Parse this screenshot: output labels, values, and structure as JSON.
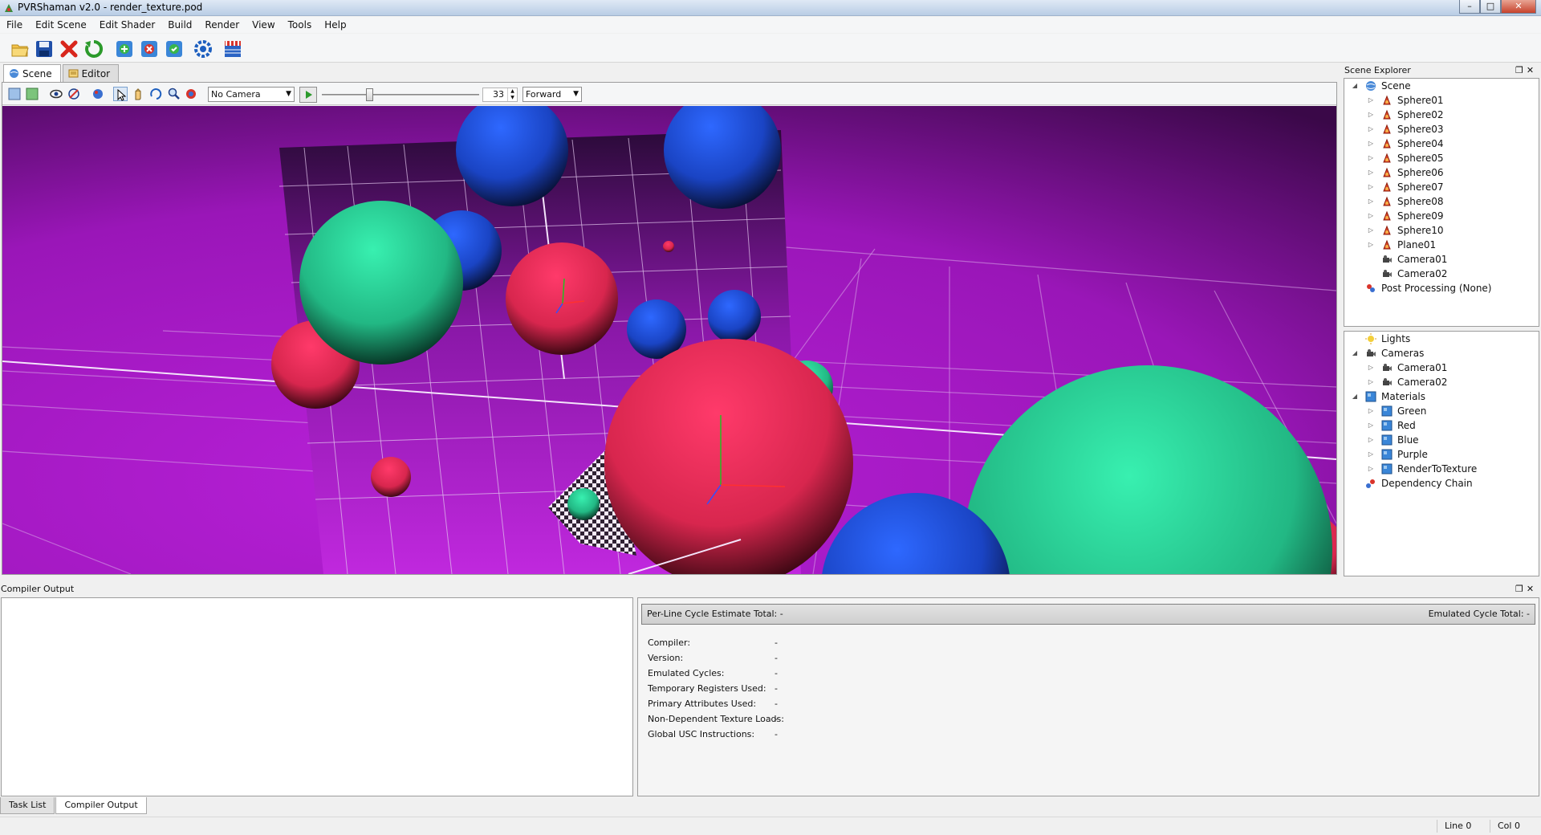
{
  "window": {
    "title": "PVRShaman v2.0 - render_texture.pod",
    "controls": [
      "–",
      "□",
      "✕"
    ]
  },
  "menu": [
    "File",
    "Edit Scene",
    "Edit Shader",
    "Build",
    "Render",
    "View",
    "Tools",
    "Help"
  ],
  "toolbar": {
    "buttons": [
      "open-icon",
      "save-icon",
      "close-file-icon",
      "reload-icon",
      "add-icon",
      "remove-icon",
      "refresh-icon",
      "settings-icon",
      "clapperboard-icon"
    ]
  },
  "view_tabs": [
    {
      "label": "Scene",
      "active": true
    },
    {
      "label": "Editor",
      "active": false
    }
  ],
  "viewport_toolbar": {
    "camera": "No Camera",
    "frame": "33",
    "mode": "Forward",
    "slider_position_fraction": 0.3
  },
  "scene_explorer": {
    "title": "Scene Explorer",
    "tree": [
      {
        "label": "Scene",
        "icon": "globe-icon",
        "level": 0,
        "expander": "◢"
      },
      {
        "label": "Sphere01",
        "icon": "mesh-icon",
        "level": 1,
        "expander": "▷"
      },
      {
        "label": "Sphere02",
        "icon": "mesh-icon",
        "level": 1,
        "expander": "▷"
      },
      {
        "label": "Sphere03",
        "icon": "mesh-icon",
        "level": 1,
        "expander": "▷"
      },
      {
        "label": "Sphere04",
        "icon": "mesh-icon",
        "level": 1,
        "expander": "▷"
      },
      {
        "label": "Sphere05",
        "icon": "mesh-icon",
        "level": 1,
        "expander": "▷"
      },
      {
        "label": "Sphere06",
        "icon": "mesh-icon",
        "level": 1,
        "expander": "▷"
      },
      {
        "label": "Sphere07",
        "icon": "mesh-icon",
        "level": 1,
        "expander": "▷"
      },
      {
        "label": "Sphere08",
        "icon": "mesh-icon",
        "level": 1,
        "expander": "▷"
      },
      {
        "label": "Sphere09",
        "icon": "mesh-icon",
        "level": 1,
        "expander": "▷"
      },
      {
        "label": "Sphere10",
        "icon": "mesh-icon",
        "level": 1,
        "expander": "▷"
      },
      {
        "label": "Plane01",
        "icon": "mesh-icon",
        "level": 1,
        "expander": "▷"
      },
      {
        "label": "Camera01",
        "icon": "camera-icon",
        "level": 1,
        "expander": ""
      },
      {
        "label": "Camera02",
        "icon": "camera-icon",
        "level": 1,
        "expander": ""
      },
      {
        "label": "Post Processing (None)",
        "icon": "post-processing-icon",
        "level": 0,
        "expander": ""
      }
    ],
    "resources": [
      {
        "label": "Lights",
        "icon": "light-icon",
        "level": 0,
        "expander": ""
      },
      {
        "label": "Cameras",
        "icon": "camera-icon",
        "level": 0,
        "expander": "◢"
      },
      {
        "label": "Camera01",
        "icon": "camera-icon",
        "level": 1,
        "expander": "▷"
      },
      {
        "label": "Camera02",
        "icon": "camera-icon",
        "level": 1,
        "expander": "▷"
      },
      {
        "label": "Materials",
        "icon": "material-icon",
        "level": 0,
        "expander": "◢"
      },
      {
        "label": "Green",
        "icon": "material-icon",
        "level": 1,
        "expander": "▷"
      },
      {
        "label": "Red",
        "icon": "material-icon",
        "level": 1,
        "expander": "▷"
      },
      {
        "label": "Blue",
        "icon": "material-icon",
        "level": 1,
        "expander": "▷"
      },
      {
        "label": "Purple",
        "icon": "material-icon",
        "level": 1,
        "expander": "▷"
      },
      {
        "label": "RenderToTexture",
        "icon": "material-icon",
        "level": 1,
        "expander": "▷"
      },
      {
        "label": "Dependency Chain",
        "icon": "dependency-icon",
        "level": 0,
        "expander": ""
      }
    ]
  },
  "compiler_output": {
    "title": "Compiler Output",
    "header_left": "Per-Line Cycle Estimate Total:  -",
    "header_right": "Emulated Cycle Total:  -",
    "stats": [
      {
        "label": "Compiler:",
        "value": "-"
      },
      {
        "label": "Version:",
        "value": "-"
      },
      {
        "label": "Emulated Cycles:",
        "value": "-"
      },
      {
        "label": "Temporary Registers Used:",
        "value": "-"
      },
      {
        "label": "Primary Attributes Used:",
        "value": "-"
      },
      {
        "label": "Non-Dependent Texture Loads:",
        "value": "-"
      },
      {
        "label": "Global USC Instructions:",
        "value": "-"
      }
    ]
  },
  "bottom_tabs": [
    {
      "label": "Task List",
      "active": false
    },
    {
      "label": "Compiler Output",
      "active": true
    }
  ],
  "status": {
    "line": "Line 0",
    "col": "Col 0"
  },
  "colors": {
    "background_purple": "#a41ac4",
    "sphere_blue": "#1d4fd8",
    "sphere_red": "#f0305e",
    "sphere_green": "#2ee0a0"
  }
}
